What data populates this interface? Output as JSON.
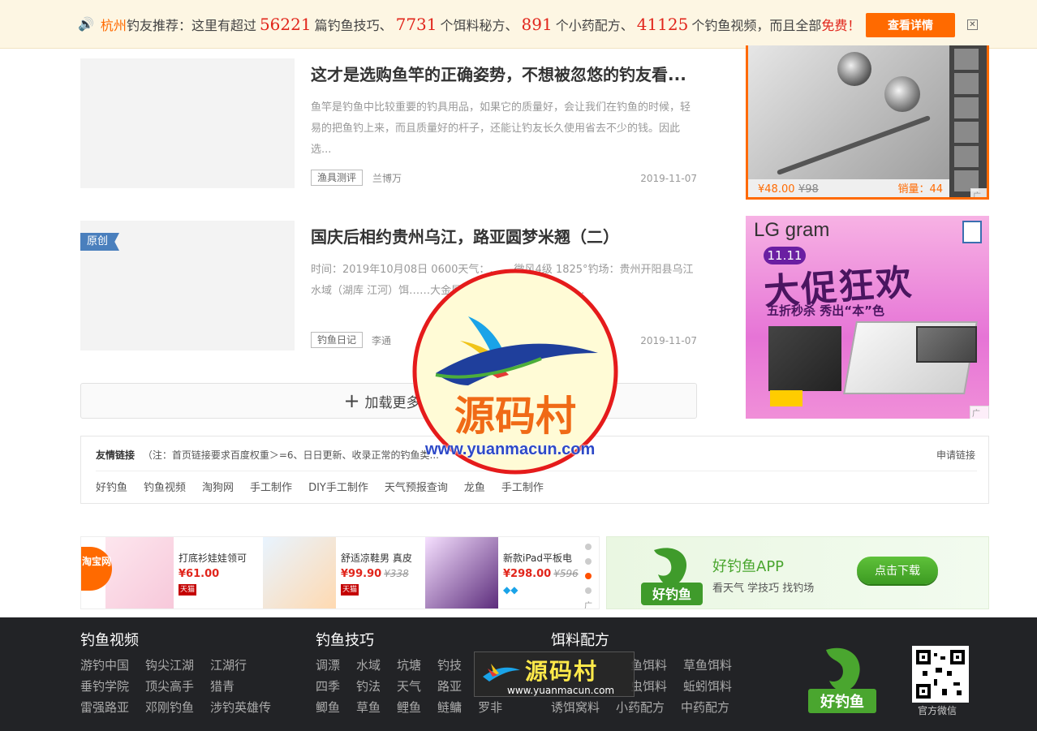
{
  "topbar": {
    "city": "杭州",
    "text1": "钓友推荐：这里有超过",
    "n1": "56221",
    "text2": "篇钓鱼技巧、",
    "n2": "7731",
    "text3": "个饵料秘方、",
    "n3": "891",
    "text4": "个小药配方、",
    "n4": "41125",
    "text5": "个钓鱼视频，而且全部",
    "free": "免费",
    "bang": "！",
    "detail": "查看详情",
    "close": "✕"
  },
  "articles": [
    {
      "title": "这才是选购鱼竿的正确姿势，不想被忽悠的钓友看...",
      "desc": "鱼竿是钓鱼中比较重要的钓具用品，如果它的质量好，会让我们在钓鱼的时候，轻易的把鱼钓上来，而且质量好的杆子，还能让钓友长久使用省去不少的钱。因此选...",
      "tag": "渔具测评",
      "author": "兰博万",
      "date": "2019-11-07",
      "badge": ""
    },
    {
      "title": "国庆后相约贵州乌江，路亚圆梦米翘（二）",
      "desc": "时间：2019年10月08日 0600天气：…… 微风4级 1825°钓场：贵州开阳县乌江水域（湖库 江河）饵……大金属VIB钓法：路亚钓竿长：...",
      "tag": "钓鱼日记",
      "author": "李通",
      "date": "2019-11-07",
      "badge": "原创"
    }
  ],
  "loadmore": {
    "label": "加载更多内"
  },
  "ad1": {
    "price": "¥48.00",
    "old": "¥98",
    "sales": "销量：44",
    "tag": "广告"
  },
  "ad2": {
    "brand": "LG gram",
    "date": "11.11",
    "promo": "大促狂欢",
    "sub": "五折秒杀 秀出“本”色",
    "tag": "广告"
  },
  "links": {
    "title": "友情链接",
    "note": "（注：首页链接要求百度权重＞=6、日日更新、收录正常的钓鱼类...",
    "apply": "申请链接",
    "items": [
      "好钓鱼",
      "钓鱼视频",
      "淘狗网",
      "手工制作",
      "DIY手工制作",
      "天气预报查询",
      "龙鱼",
      "手工制作"
    ]
  },
  "taobao": {
    "logo": "淘宝网",
    "products": [
      {
        "name": "打底衫娃娃领可",
        "price": "¥61.00",
        "old": "",
        "badge": "天猫"
      },
      {
        "name": "舒适凉鞋男 真皮",
        "price": "¥99.90",
        "old": "¥338",
        "badge": "天猫"
      },
      {
        "name": "新款iPad平板电",
        "price": "¥298.00",
        "old": "¥596",
        "badge": ""
      }
    ],
    "tag": "广告"
  },
  "app_ad": {
    "app": "好钓鱼APP",
    "slogan": "看天气 学技巧 找钓场",
    "download": "点击下载",
    "logo": "好钓鱼"
  },
  "footer": {
    "cols": [
      {
        "title": "钓鱼视频",
        "rows": [
          [
            "游钓中国",
            "钩尖江湖",
            "江湖行"
          ],
          [
            "垂钓学院",
            "顶尖高手",
            "猎青"
          ],
          [
            "雷强路亚",
            "邓刚钓鱼",
            "涉钓英雄传"
          ]
        ]
      },
      {
        "title": "钓鱼技巧",
        "rows": [
          [
            "调漂",
            "水域",
            "坑塘",
            "钓技"
          ],
          [
            "四季",
            "钓法",
            "天气",
            "路亚"
          ],
          [
            "鲫鱼",
            "草鱼",
            "鲤鱼",
            "鲢鳙",
            "罗非"
          ]
        ]
      },
      {
        "title": "饵料配方",
        "rows": [
          [
            "鱼饵料",
            "草鱼饵料"
          ],
          [
            "虫饵料",
            "蚯蚓饵料"
          ],
          [
            "诱饵窝料",
            "小药配方",
            "中药配方"
          ]
        ]
      }
    ],
    "logo": "好钓鱼",
    "qr_caption": "官方微信"
  },
  "watermark": {
    "text": "源码村",
    "url": "www.yuanmacun.com"
  }
}
